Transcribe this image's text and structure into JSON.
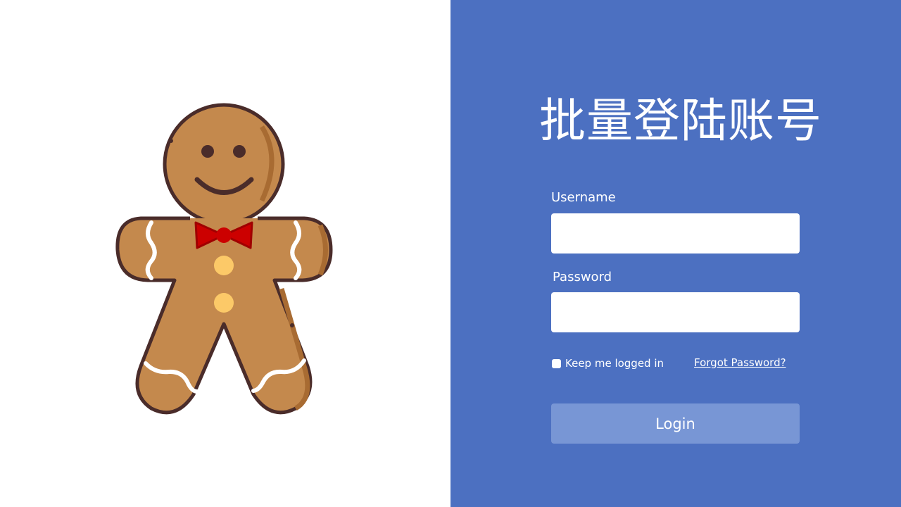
{
  "title": "批量登陆账号",
  "form": {
    "username_label": "Username",
    "username_value": "",
    "password_label": "Password",
    "password_value": "",
    "remember_label": "Keep me logged in",
    "remember_checked": false,
    "forgot_label": "Forgot Password?",
    "login_label": "Login"
  },
  "illustration": {
    "icon": "gingerbread-man-icon"
  },
  "colors": {
    "panel_background": "#4c70c1",
    "button_background": "#7896d5",
    "cookie": "#c4894d",
    "cookie_outline": "#4a2c2a",
    "bow": "#cc0000",
    "buttons": "#fcc968"
  }
}
